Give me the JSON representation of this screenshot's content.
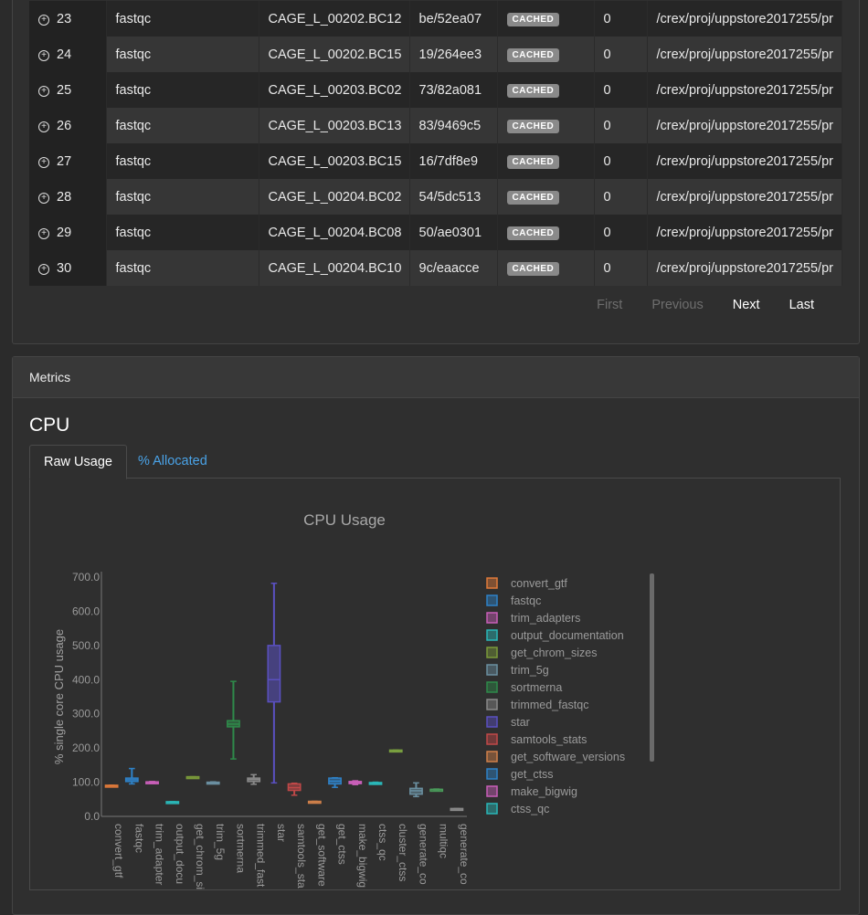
{
  "rows": [
    {
      "idx": "23",
      "process": "fastqc",
      "tag": "CAGE_L_00202.BC12",
      "hash": "be/52ea07",
      "status": "CACHED",
      "exit": "0",
      "workdir": "/crex/proj/uppstore2017255/pr"
    },
    {
      "idx": "24",
      "process": "fastqc",
      "tag": "CAGE_L_00202.BC15",
      "hash": "19/264ee3",
      "status": "CACHED",
      "exit": "0",
      "workdir": "/crex/proj/uppstore2017255/pr"
    },
    {
      "idx": "25",
      "process": "fastqc",
      "tag": "CAGE_L_00203.BC02",
      "hash": "73/82a081",
      "status": "CACHED",
      "exit": "0",
      "workdir": "/crex/proj/uppstore2017255/pr"
    },
    {
      "idx": "26",
      "process": "fastqc",
      "tag": "CAGE_L_00203.BC13",
      "hash": "83/9469c5",
      "status": "CACHED",
      "exit": "0",
      "workdir": "/crex/proj/uppstore2017255/pr"
    },
    {
      "idx": "27",
      "process": "fastqc",
      "tag": "CAGE_L_00203.BC15",
      "hash": "16/7df8e9",
      "status": "CACHED",
      "exit": "0",
      "workdir": "/crex/proj/uppstore2017255/pr"
    },
    {
      "idx": "28",
      "process": "fastqc",
      "tag": "CAGE_L_00204.BC02",
      "hash": "54/5dc513",
      "status": "CACHED",
      "exit": "0",
      "workdir": "/crex/proj/uppstore2017255/pr"
    },
    {
      "idx": "29",
      "process": "fastqc",
      "tag": "CAGE_L_00204.BC08",
      "hash": "50/ae0301",
      "status": "CACHED",
      "exit": "0",
      "workdir": "/crex/proj/uppstore2017255/pr"
    },
    {
      "idx": "30",
      "process": "fastqc",
      "tag": "CAGE_L_00204.BC10",
      "hash": "9c/eaacce",
      "status": "CACHED",
      "exit": "0",
      "workdir": "/crex/proj/uppstore2017255/pr"
    }
  ],
  "pager": {
    "first": "First",
    "previous": "Previous",
    "next": "Next",
    "last": "Last"
  },
  "metrics": {
    "header": "Metrics",
    "section_title": "CPU",
    "tab_raw": "Raw Usage",
    "tab_alloc": "% Allocated"
  },
  "icons": {
    "expand": "plus-circle-icon"
  },
  "chart_data": {
    "type": "box",
    "title": "CPU Usage",
    "ylabel": "% single core CPU usage",
    "ylim": [
      0,
      700
    ],
    "yticks": [
      "0.0",
      "100.0",
      "200.0",
      "300.0",
      "400.0",
      "500.0",
      "600.0",
      "700.0"
    ],
    "categories": [
      {
        "label": "convert_gtf",
        "color": "#e07a3a",
        "min": 90,
        "q1": 90,
        "median": 90,
        "q3": 91,
        "max": 91
      },
      {
        "label": "fastqc",
        "color": "#2f82c8",
        "min": 95,
        "q1": 102,
        "median": 107,
        "q3": 112,
        "max": 140
      },
      {
        "label": "trim_adapters",
        "color": "#c85fb8",
        "min": 98,
        "q1": 99,
        "median": 100,
        "q3": 101,
        "max": 102
      },
      {
        "label": "output_documentation",
        "color": "#2ab7b8",
        "min": 42,
        "q1": 42,
        "median": 42,
        "q3": 43,
        "max": 43
      },
      {
        "label": "get_chrom_sizes",
        "color": "#7a9a3a",
        "min": 115,
        "q1": 115,
        "median": 115,
        "q3": 116,
        "max": 116
      },
      {
        "label": "trim_5g",
        "color": "#6a8fa0",
        "min": 96,
        "q1": 97,
        "median": 98,
        "q3": 100,
        "max": 101
      },
      {
        "label": "sortmerna",
        "color": "#2f8a4a",
        "min": 168,
        "q1": 262,
        "median": 270,
        "q3": 280,
        "max": 395
      },
      {
        "label": "trimmed_fastqc",
        "color": "#8a8a8a",
        "min": 94,
        "q1": 102,
        "median": 108,
        "q3": 112,
        "max": 122
      },
      {
        "label": "star",
        "color": "#5a50c0",
        "min": 98,
        "q1": 335,
        "median": 400,
        "q3": 500,
        "max": 682
      },
      {
        "label": "samtools_stats",
        "color": "#c04848",
        "min": 62,
        "q1": 76,
        "median": 84,
        "q3": 95,
        "max": 97
      },
      {
        "label": "get_software_versions",
        "color": "#d0804a",
        "min": 43,
        "q1": 43,
        "median": 43,
        "q3": 44,
        "max": 44
      },
      {
        "label": "get_ctss",
        "color": "#2f82c8",
        "min": 85,
        "q1": 95,
        "median": 103,
        "q3": 112,
        "max": 113
      },
      {
        "label": "make_bigwig",
        "color": "#c85fb8",
        "min": 93,
        "q1": 96,
        "median": 99,
        "q3": 102,
        "max": 104
      },
      {
        "label": "ctss_qc",
        "color": "#2ab7b8",
        "min": 94,
        "q1": 95,
        "median": 97,
        "q3": 99,
        "max": 100
      },
      {
        "label": "cluster_ctss",
        "color": "#7aa040",
        "min": 192,
        "q1": 192,
        "median": 193,
        "q3": 194,
        "max": 194
      },
      {
        "label": "generate_consensus",
        "color": "#6a8fa0",
        "min": 58,
        "q1": 65,
        "median": 75,
        "q3": 82,
        "max": 98
      },
      {
        "label": "multiqc",
        "color": "#4a9a5a",
        "min": 78,
        "q1": 78,
        "median": 79,
        "q3": 79,
        "max": 80
      },
      {
        "label": "generate_counts",
        "color": "#8a8a8a",
        "min": 22,
        "q1": 22,
        "median": 22,
        "q3": 23,
        "max": 23
      }
    ],
    "xtick_labels": [
      "convert_gtf",
      "fastqc",
      "trim_adapter",
      "output_docu",
      "get_chrom_si",
      "trim_5g",
      "sortmerna",
      "trimmed_fast",
      "star",
      "samtools_sta",
      "get_software",
      "get_ctss",
      "make_bigwig",
      "ctss_qc",
      "cluster_ctss",
      "generate_co",
      "multiqc",
      "generate_co"
    ],
    "legend": [
      "convert_gtf",
      "fastqc",
      "trim_adapters",
      "output_documentation",
      "get_chrom_sizes",
      "trim_5g",
      "sortmerna",
      "trimmed_fastqc",
      "star",
      "samtools_stats",
      "get_software_versions",
      "get_ctss",
      "make_bigwig",
      "ctss_qc"
    ],
    "legend_position": "right",
    "grid": false
  }
}
